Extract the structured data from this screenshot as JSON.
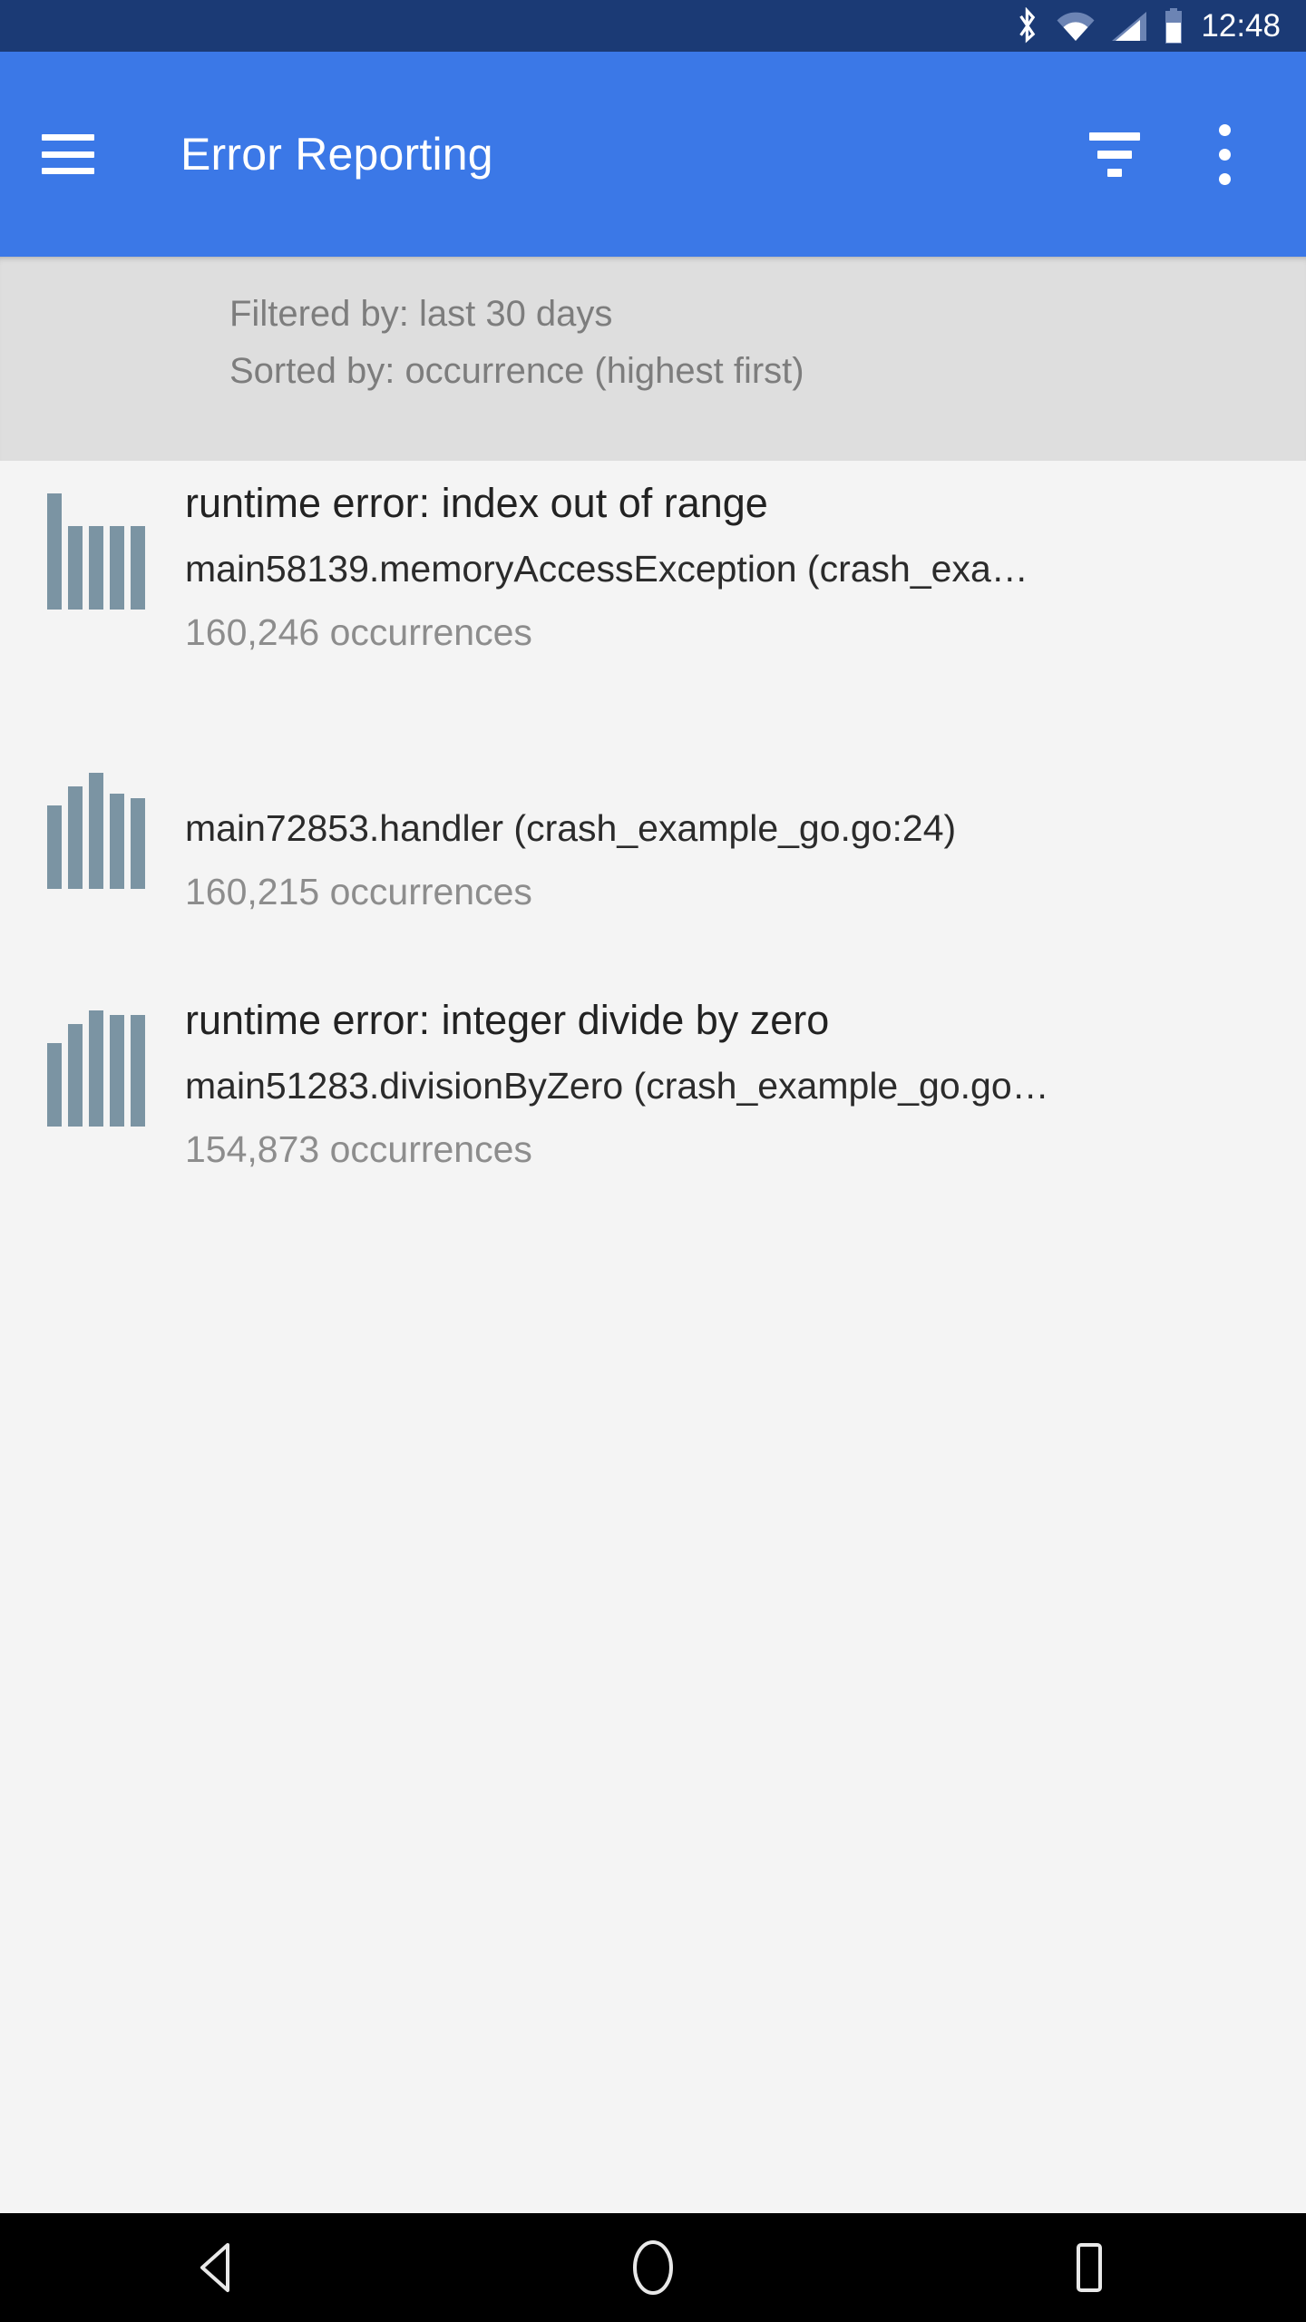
{
  "status_bar": {
    "time": "12:48",
    "icons": [
      "bluetooth-icon",
      "wifi-icon",
      "cellular-signal-icon",
      "battery-icon"
    ],
    "background_color": "#1b3a75"
  },
  "app_bar": {
    "title": "Error Reporting",
    "menu_icon": "hamburger-menu-icon",
    "filter_icon": "filter-icon",
    "overflow_icon": "overflow-menu-icon",
    "background_color": "#3b78e7",
    "text_color": "#ffffff"
  },
  "filter_bar": {
    "filtered_by": "Filtered by: last 30 days",
    "sorted_by": "Sorted by: occurrence (highest first)",
    "background_color": "#dedede",
    "text_color": "#7d7d7d"
  },
  "errors": [
    {
      "title": "runtime error: index out of range",
      "subtitle": "main58139.memoryAccessException (crash_exa…",
      "occurrences": "160,246 occurrences",
      "sparkline": [
        100,
        72,
        72,
        72,
        72
      ]
    },
    {
      "title": "",
      "subtitle": "main72853.handler (crash_example_go.go:24)",
      "occurrences": "160,215 occurrences",
      "sparkline": [
        72,
        88,
        100,
        82,
        78
      ]
    },
    {
      "title": "runtime error: integer divide by zero",
      "subtitle": "main51283.divisionByZero (crash_example_go.go…",
      "occurrences": "154,873 occurrences",
      "sparkline": [
        72,
        88,
        100,
        96,
        96
      ]
    }
  ],
  "sparkline_color": "#7b94a3",
  "nav_bar": {
    "back": "back-triangle-icon",
    "home": "home-circle-icon",
    "recents": "recents-square-icon",
    "background_color": "#000000"
  }
}
